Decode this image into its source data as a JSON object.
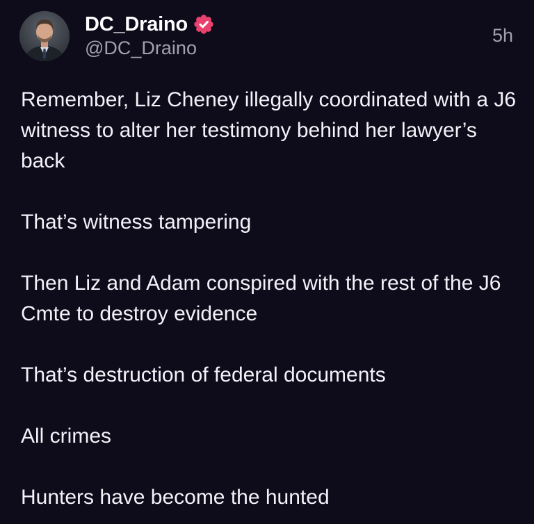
{
  "post": {
    "author": {
      "display_name": "DC_Draino",
      "handle": "@DC_Draino",
      "verified": true,
      "verified_color": "#e8416e",
      "avatar_icon": "profile-photo"
    },
    "timestamp": "5h",
    "paragraphs": [
      "Remember, Liz Cheney illegally coordinated with a J6 witness to alter her testimony behind her lawyer’s back",
      "That’s witness tampering",
      "Then Liz and Adam conspired with the rest of the J6 Cmte to destroy evidence",
      "That’s destruction of federal documents",
      "All crimes",
      "Hunters have become the hunted"
    ]
  },
  "colors": {
    "background": "#0e0b1b",
    "text": "#f3f2f8",
    "muted": "#a3a1ad"
  }
}
